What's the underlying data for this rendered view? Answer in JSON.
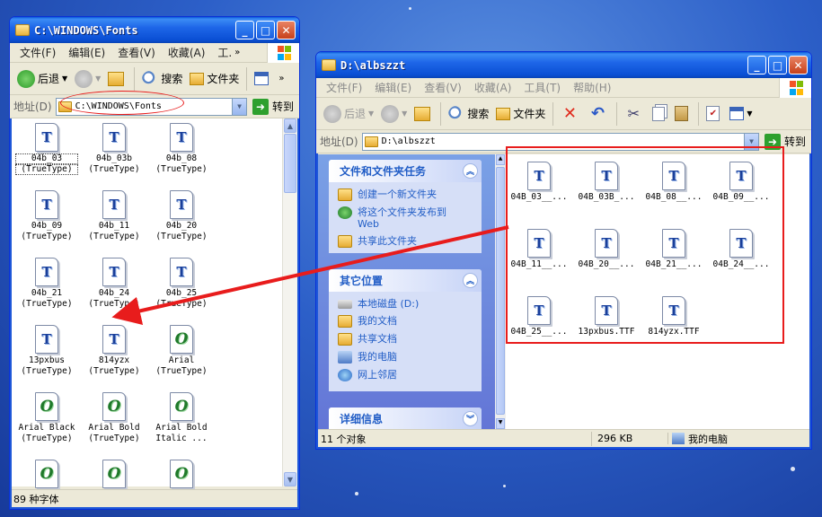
{
  "left_window": {
    "title": "C:\\WINDOWS\\Fonts",
    "menu": [
      "文件(F)",
      "编辑(E)",
      "查看(V)",
      "收藏(A)",
      "工."
    ],
    "toolbar": {
      "back": "后退",
      "search": "搜索",
      "folders": "文件夹"
    },
    "address_label": "地址(D)",
    "address_value": "C:\\WINDOWS\\Fonts",
    "go_label": "转到",
    "fonts": [
      {
        "line1": "04b_03",
        "line2": "(TrueType)",
        "kind": "ttf"
      },
      {
        "line1": "04b_03b",
        "line2": "(TrueType)",
        "kind": "ttf"
      },
      {
        "line1": "04b_08",
        "line2": "(TrueType)",
        "kind": "ttf"
      },
      {
        "line1": "04b_09",
        "line2": "(TrueType)",
        "kind": "ttf"
      },
      {
        "line1": "04b_11",
        "line2": "(TrueType)",
        "kind": "ttf"
      },
      {
        "line1": "04b_20",
        "line2": "(TrueType)",
        "kind": "ttf"
      },
      {
        "line1": "04b_21",
        "line2": "(TrueType)",
        "kind": "ttf"
      },
      {
        "line1": "04b_24",
        "line2": "(TrueType)",
        "kind": "ttf"
      },
      {
        "line1": "04b_25",
        "line2": "(TrueType)",
        "kind": "ttf"
      },
      {
        "line1": "13pxbus",
        "line2": "(TrueType)",
        "kind": "ttf"
      },
      {
        "line1": "814yzx",
        "line2": "(TrueType)",
        "kind": "ttf"
      },
      {
        "line1": "Arial",
        "line2": "(TrueType)",
        "kind": "otf"
      },
      {
        "line1": "Arial Black",
        "line2": "(TrueType)",
        "kind": "otf"
      },
      {
        "line1": "Arial Bold",
        "line2": "(TrueType)",
        "kind": "otf"
      },
      {
        "line1": "Arial Bold",
        "line2": "Italic ...",
        "kind": "otf"
      },
      {
        "line1": "",
        "line2": "",
        "kind": "otf"
      },
      {
        "line1": "",
        "line2": "",
        "kind": "otf"
      },
      {
        "line1": "",
        "line2": "",
        "kind": "otf"
      }
    ],
    "status": "89 种字体"
  },
  "right_window": {
    "title": "D:\\albszzt",
    "menu": [
      "文件(F)",
      "编辑(E)",
      "查看(V)",
      "收藏(A)",
      "工具(T)",
      "帮助(H)"
    ],
    "toolbar": {
      "back": "后退",
      "search": "搜索",
      "folders": "文件夹"
    },
    "address_label": "地址(D)",
    "address_value": "D:\\albszzt",
    "go_label": "转到",
    "tasks_panel": {
      "title": "文件和文件夹任务",
      "items": [
        "创建一个新文件夹",
        "将这个文件夹发布到 Web",
        "共享此文件夹"
      ]
    },
    "places_panel": {
      "title": "其它位置",
      "items": [
        "本地磁盘 (D:)",
        "我的文档",
        "共享文档",
        "我的电脑",
        "网上邻居"
      ]
    },
    "details_panel": {
      "title": "详细信息"
    },
    "files": [
      "04B_03__...",
      "04B_03B_...",
      "04B_08__...",
      "04B_09__...",
      "04B_11__...",
      "04B_20__...",
      "04B_21__...",
      "04B_24__...",
      "04B_25__...",
      "13pxbus.TTF",
      "814yzx.TTF"
    ],
    "status": {
      "count": "11 个对象",
      "size": "296 KB",
      "location": "我的电脑"
    }
  },
  "colors": {
    "annotation_red": "#e81c1c",
    "xp_blue": "#0a5bd8",
    "link_blue": "#215dc6"
  }
}
